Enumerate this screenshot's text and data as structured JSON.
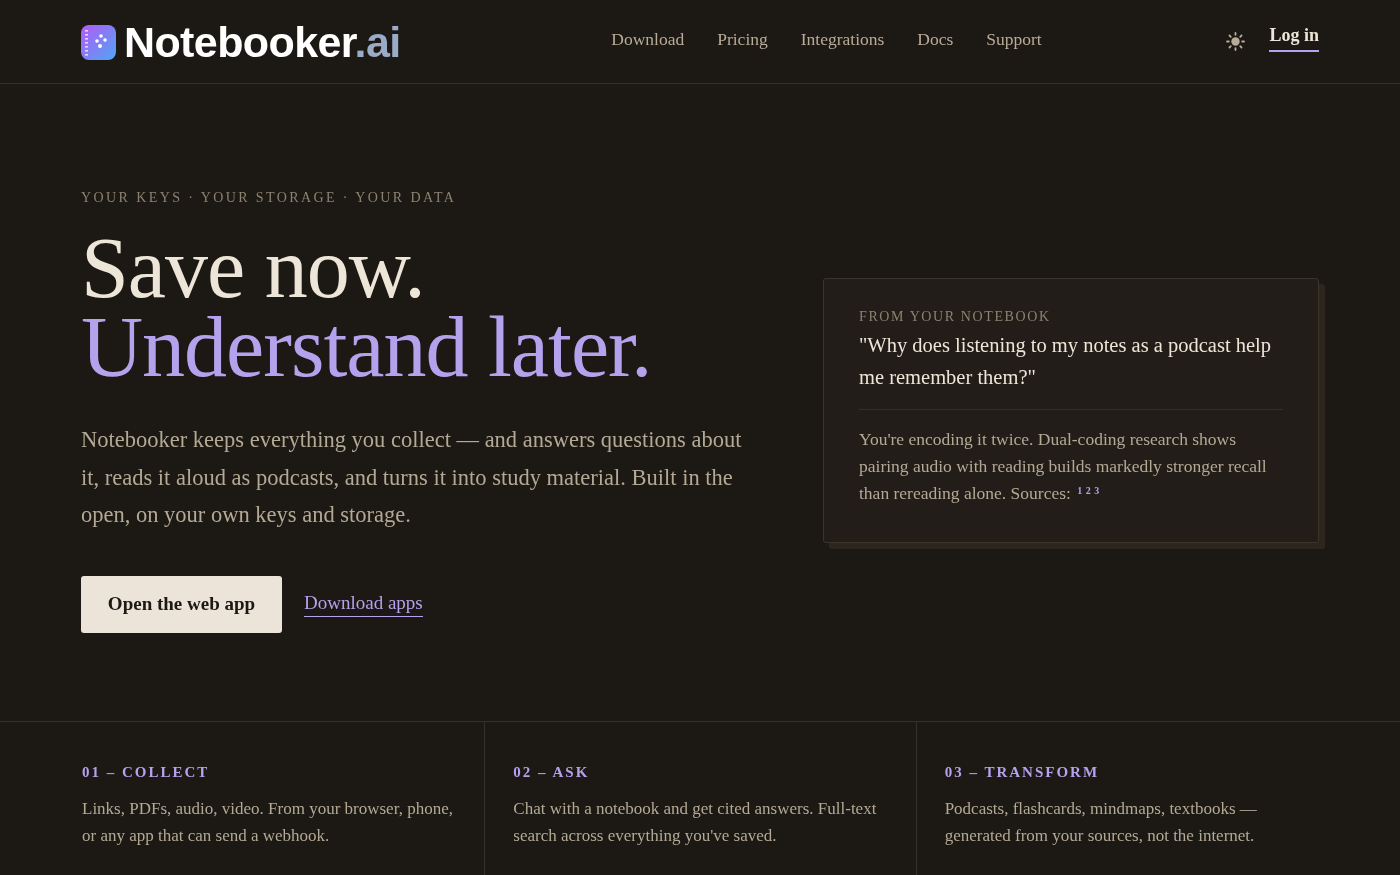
{
  "header": {
    "logo": {
      "name": "Notebooker",
      "suffix": ".ai"
    },
    "nav": [
      "Download",
      "Pricing",
      "Integrations",
      "Docs",
      "Support"
    ],
    "login": "Log in"
  },
  "hero": {
    "eyebrow": "YOUR KEYS · YOUR STORAGE · YOUR DATA",
    "headline": [
      {
        "text": "Save now.",
        "kind": "plain"
      },
      {
        "text": "Understand later.",
        "kind": "accent"
      }
    ],
    "description": "Notebooker keeps everything you collect — and answers questions about it, reads it aloud as podcasts, and turns it into study material. Built in the open, on your own keys and storage.",
    "primary_button": "Open the web app",
    "secondary_link": "Download apps"
  },
  "card": {
    "label": "FROM YOUR NOTEBOOK",
    "question": "\"Why does listening to my notes as a podcast help me remember them?\"",
    "answer": "You're encoding it twice. Dual-coding research shows pairing audio with reading builds markedly stronger recall than rereading alone. Sources: $^{1 2 3}$"
  },
  "features": [
    {
      "title": "01 – COLLECT",
      "text": "Links, PDFs, audio, video. From your browser, phone, or any app that can send a webhook."
    },
    {
      "title": "02 – ASK",
      "text": "Chat with a notebook and get cited answers. Full-text search across everything you've saved."
    },
    {
      "title": "03 – TRANSFORM",
      "text": "Podcasts, flashcards, mindmaps, textbooks — generated from your sources, not the internet."
    }
  ]
}
